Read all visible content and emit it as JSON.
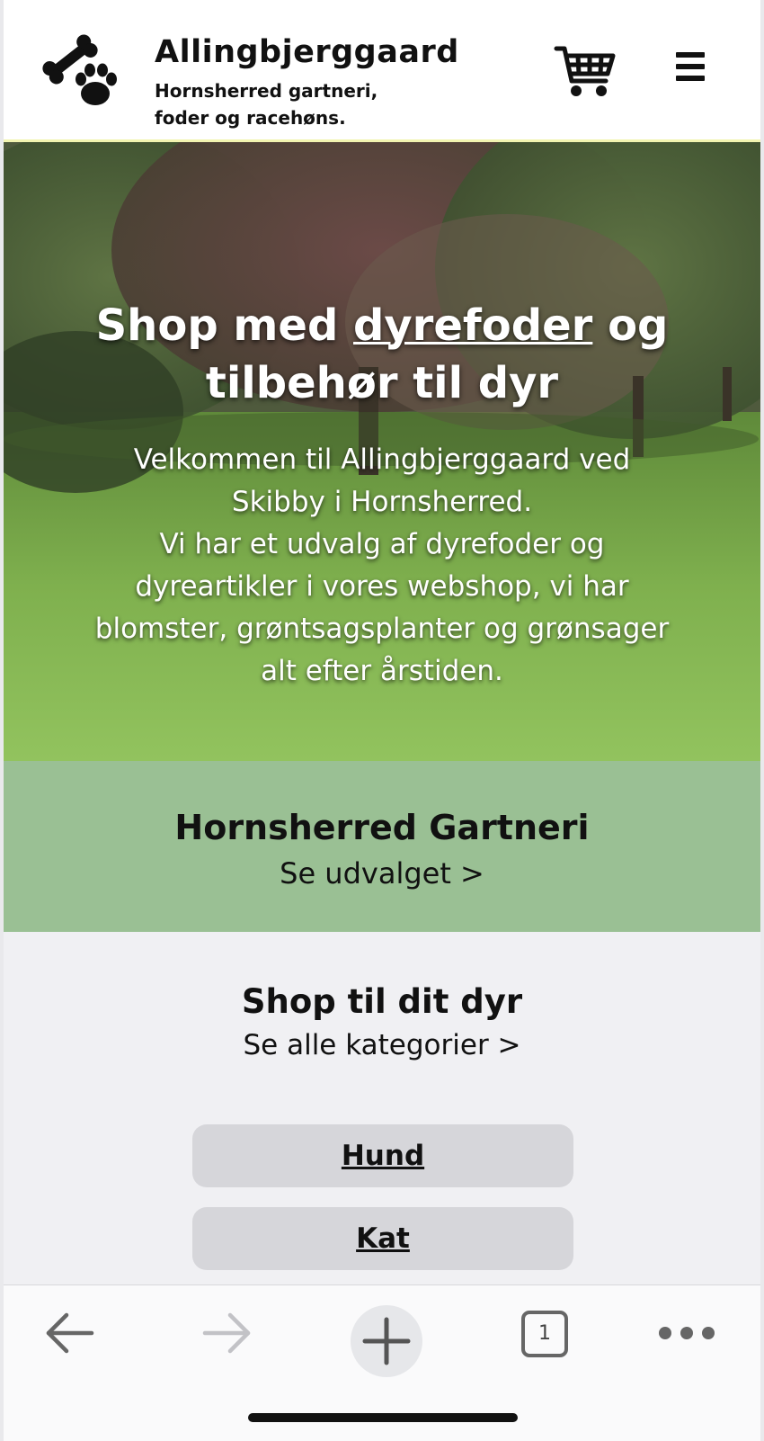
{
  "header": {
    "title": "Allingbjerggaard",
    "subtitle_line1": "Hornsherred gartneri,",
    "subtitle_line2": "foder og racehøns.",
    "logo_icon": "bone-paw-icon",
    "cart_icon": "shopping-cart-icon",
    "menu_icon": "hamburger-menu-icon"
  },
  "hero": {
    "title_before": "Shop med ",
    "title_link": "dyrefoder",
    "title_after": " og",
    "title_line2": "tilbehør til dyr",
    "text_line1": "Velkommen til Allingbjerggaard ved",
    "text_line2": "Skibby i Hornsherred.",
    "text_line3": "Vi har et udvalg af dyrefoder og",
    "text_line4": "dyreartikler i vores webshop, vi har",
    "text_line5": "blomster, grøntsagsplanter og grønsager",
    "text_line6": "alt efter årstiden."
  },
  "gartneri": {
    "title": "Hornsherred Gartneri",
    "link": "Se udvalget >"
  },
  "shop": {
    "title": "Shop til dit dyr",
    "link": "Se alle kategorier >",
    "categories": [
      "Hund",
      "Kat"
    ]
  },
  "toolbar": {
    "tab_count": "1",
    "icons": [
      "back-arrow-icon",
      "forward-arrow-icon",
      "new-tab-plus-icon",
      "tabs-icon",
      "more-icon"
    ]
  },
  "colors": {
    "gartneri_bg": "#9ac094",
    "shop_bg": "#f0f0f3",
    "button_bg": "#d6d6da"
  }
}
